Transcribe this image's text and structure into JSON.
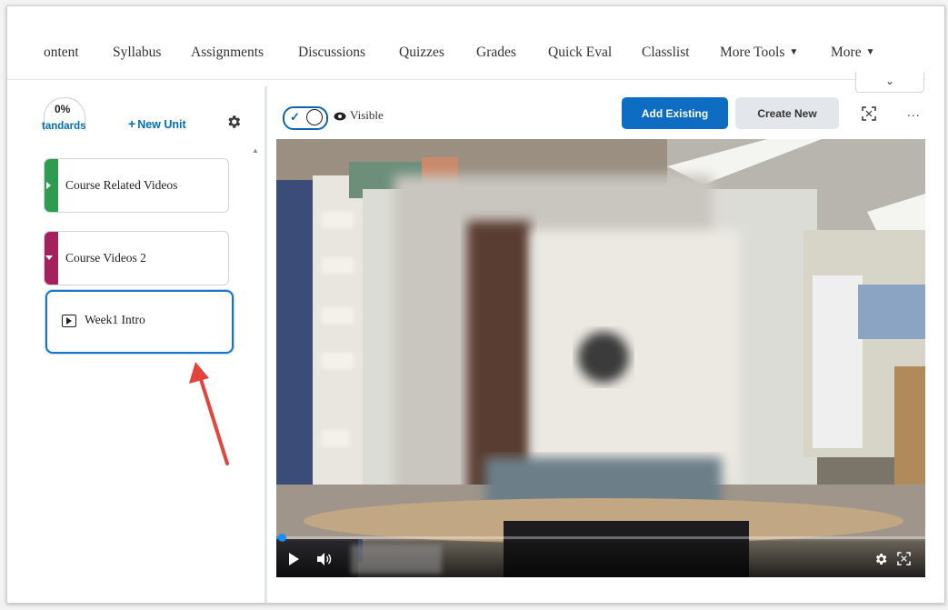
{
  "nav": {
    "items": [
      "ontent",
      "Syllabus",
      "Assignments",
      "Discussions",
      "Quizzes",
      "Grades",
      "Quick Eval",
      "Classlist",
      "More Tools",
      "More"
    ]
  },
  "sidebar": {
    "standards_percent": "0%",
    "standards_label": "tandards",
    "new_unit_label": "New Unit",
    "units": [
      {
        "title": "Course Related Videos",
        "color": "#2e9c50"
      },
      {
        "title": "Course Videos 2",
        "color": "#a3225e"
      }
    ],
    "selected_item": "Week1 Intro"
  },
  "toolbar": {
    "visibility_label": "Visible",
    "add_existing_label": "Add Existing",
    "create_new_label": "Create New",
    "more_label": "..."
  },
  "video": {
    "progress": 0.01
  },
  "colors": {
    "primary": "#0e6dc3",
    "selection_border": "#1b74c7",
    "annotation_arrow": "#e2453c"
  }
}
